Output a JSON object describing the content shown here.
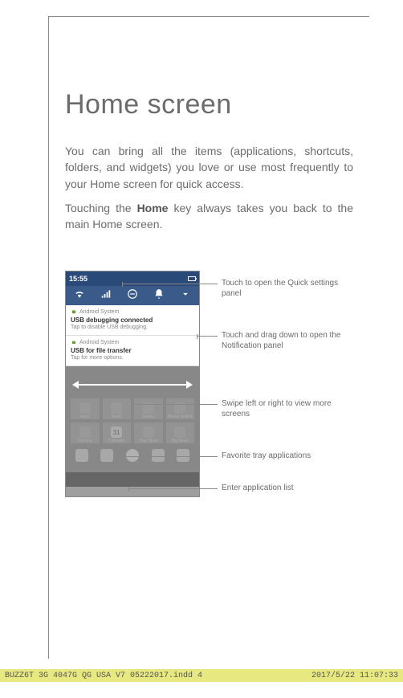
{
  "title": "Home screen",
  "para1": "You can bring all the items (applications, shortcuts, folders, and widgets) you love or use most frequently to your Home screen for quick access.",
  "para2_before": "Touching the ",
  "para2_bold": "Home",
  "para2_after": " key always takes you back to the main Home screen.",
  "phone": {
    "time": "15:55",
    "notif1": {
      "app": "Android System",
      "title": "USB debugging connected",
      "sub": "Tap to disable USB debugging."
    },
    "notif2": {
      "app": "Android System",
      "title": "USB for file transfer",
      "sub": "Tap for more options."
    },
    "apps": {
      "a0": "Apps",
      "a1": "Music",
      "a2": "Gallery",
      "a3": "Phone Switch",
      "a4": "Chrome",
      "a5": "Calendar",
      "a6": "Play Store",
      "a7": "Big Stock"
    },
    "cal_day": "31"
  },
  "callouts": {
    "c1": "Touch to open the Quick settings panel",
    "c2": "Touch and drag down to open the Notification panel",
    "c3": "Swipe left or right to view more screens",
    "c4": "Favorite tray applications",
    "c5": "Enter application list"
  },
  "footer": {
    "left": "BUZZ6T 3G 4047G QG USA V7 05222017.indd   4",
    "right": "2017/5/22   11:07:33"
  }
}
